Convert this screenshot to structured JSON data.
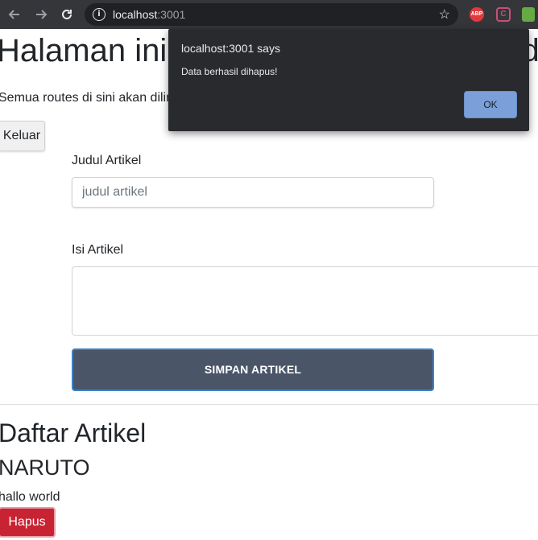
{
  "browser": {
    "url_host": "localhost",
    "url_port": ":3001",
    "extensions": [
      "ABP",
      "C"
    ]
  },
  "page": {
    "heading": "Halaman ini akan dilindungi oleh middlew",
    "lead": "Semua routes di sini akan dilindungi oleh middleware",
    "logout_label": "Keluar",
    "form": {
      "title_label": "Judul Artikel",
      "title_placeholder": "judul artikel",
      "content_label": "Isi Artikel",
      "save_label": "SIMPAN ARTIKEL"
    },
    "list_heading": "Daftar Artikel",
    "articles": [
      {
        "title": "NARUTO",
        "content": "hallo world",
        "delete_label": "Hapus"
      }
    ]
  },
  "dialog": {
    "title": "localhost:3001 says",
    "message": "Data berhasil dihapus!",
    "ok_label": "OK"
  },
  "colors": {
    "chrome_bg": "#35363a",
    "save_button": "#4a5568",
    "delete_button": "#c82333",
    "dialog_bg": "#292a2d",
    "dialog_ok": "#7b9fd8"
  }
}
